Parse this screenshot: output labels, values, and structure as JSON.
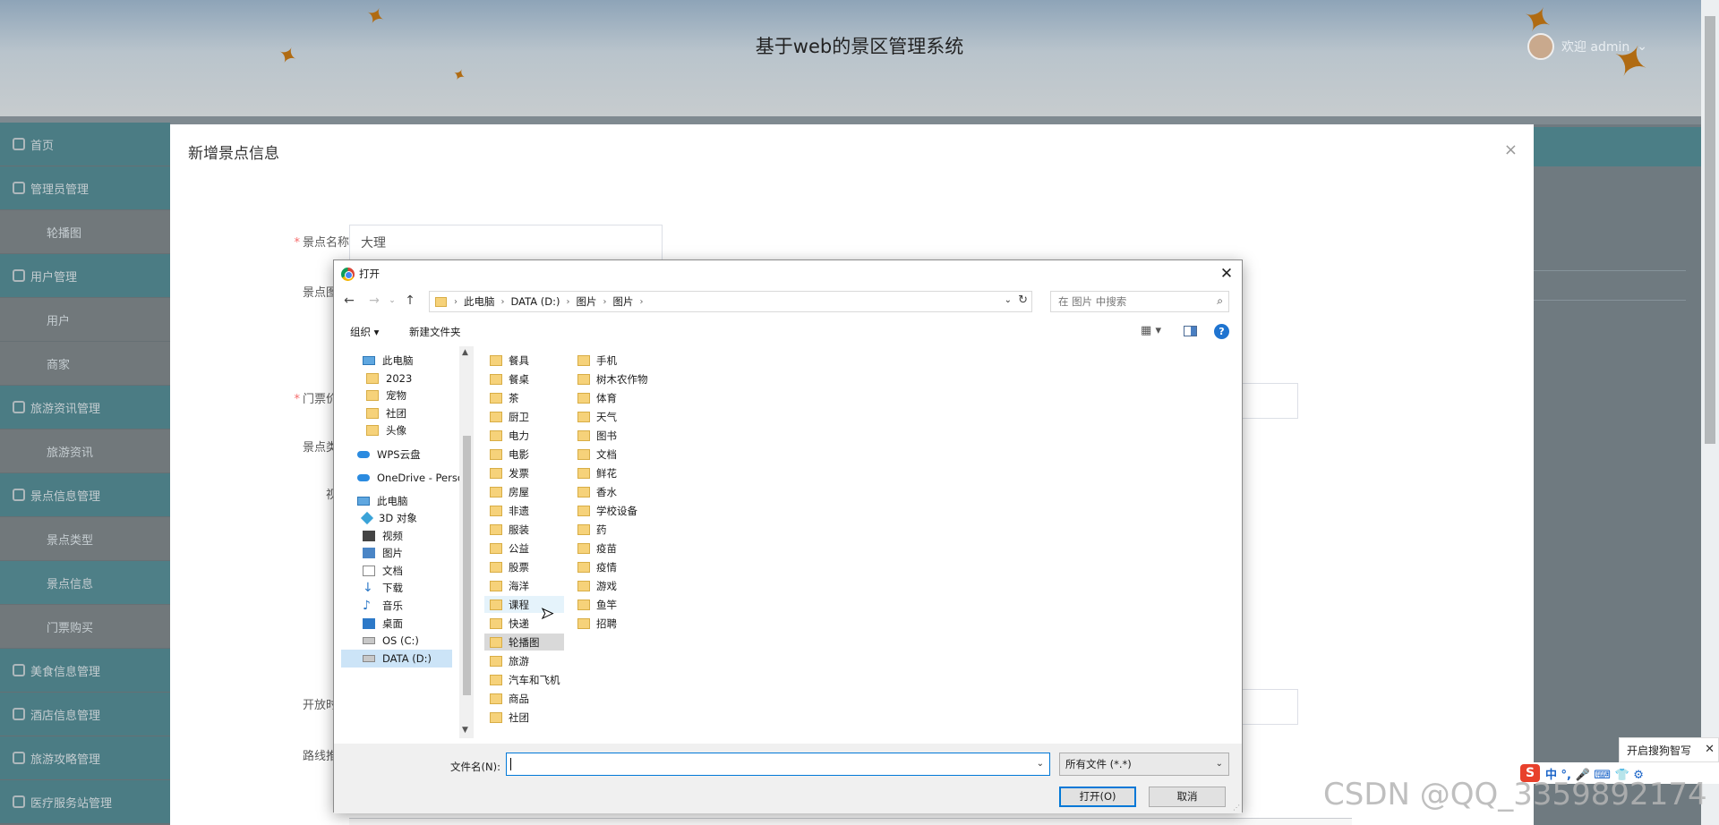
{
  "app": {
    "title": "基于web的景区管理系统",
    "welcome": "欢迎 admin"
  },
  "sidebar": {
    "items": [
      {
        "label": "首页",
        "type": "group"
      },
      {
        "label": "管理员管理",
        "type": "group"
      },
      {
        "label": "轮播图",
        "type": "sub"
      },
      {
        "label": "用户管理",
        "type": "group"
      },
      {
        "label": "用户",
        "type": "sub"
      },
      {
        "label": "商家",
        "type": "sub"
      },
      {
        "label": "旅游资讯管理",
        "type": "group"
      },
      {
        "label": "旅游资讯",
        "type": "sub"
      },
      {
        "label": "景点信息管理",
        "type": "group"
      },
      {
        "label": "景点类型",
        "type": "sub"
      },
      {
        "label": "景点信息",
        "type": "active"
      },
      {
        "label": "门票购买",
        "type": "sub"
      },
      {
        "label": "美食信息管理",
        "type": "group"
      },
      {
        "label": "酒店信息管理",
        "type": "group"
      },
      {
        "label": "旅游攻略管理",
        "type": "group"
      },
      {
        "label": "医疗服务站管理",
        "type": "group"
      }
    ]
  },
  "modal": {
    "title": "新增景点信息",
    "close_glyph": "×",
    "fields": {
      "name_label": "景点名称",
      "name_value": "大理",
      "image_label": "景点图片",
      "price_label": "门票价格",
      "type_label": "景点类型",
      "video_label": "视频",
      "open_label": "开放时间",
      "route_label": "路线推荐"
    }
  },
  "dialog": {
    "title": "打开",
    "close_glyph": "✕",
    "breadcrumb": [
      "此电脑",
      "DATA (D:)",
      "图片",
      "图片"
    ],
    "search_placeholder": "在 图片 中搜索",
    "toolbar": {
      "organize": "组织 ▾",
      "new_folder": "新建文件夹"
    },
    "nav_items": [
      {
        "label": "此电脑",
        "icon": "pc"
      },
      {
        "label": "2023",
        "icon": "folder"
      },
      {
        "label": "宠物",
        "icon": "folder"
      },
      {
        "label": "社团",
        "icon": "folder"
      },
      {
        "label": "头像",
        "icon": "folder"
      },
      {
        "label": "WPS云盘",
        "icon": "cloud"
      },
      {
        "label": "OneDrive - Perso",
        "icon": "cloud"
      },
      {
        "label": "此电脑",
        "icon": "pc"
      },
      {
        "label": "3D 对象",
        "icon": "cube"
      },
      {
        "label": "视频",
        "icon": "vid"
      },
      {
        "label": "图片",
        "icon": "pic"
      },
      {
        "label": "文档",
        "icon": "doc"
      },
      {
        "label": "下载",
        "icon": "dl"
      },
      {
        "label": "音乐",
        "icon": "music"
      },
      {
        "label": "桌面",
        "icon": "desk"
      },
      {
        "label": "OS (C:)",
        "icon": "drive"
      },
      {
        "label": "DATA (D:)",
        "icon": "drive"
      }
    ],
    "folders_col1": [
      "餐具",
      "餐桌",
      "茶",
      "厨卫",
      "电力",
      "电影",
      "发票",
      "房屋",
      "非遗",
      "服装",
      "公益",
      "股票",
      "海洋",
      "课程",
      "快递",
      "轮播图",
      "旅游",
      "汽车和飞机",
      "商品",
      "社团"
    ],
    "folders_col2": [
      "手机",
      "树木农作物",
      "体育",
      "天气",
      "图书",
      "文档",
      "鲜花",
      "香水",
      "学校设备",
      "药",
      "疫苗",
      "疫情",
      "游戏",
      "鱼竿",
      "招聘"
    ],
    "filename_label": "文件名(N):",
    "filename_value": "",
    "filetype": "所有文件 (*.*)",
    "open_button": "打开(O)",
    "cancel_button": "取消"
  },
  "overlays": {
    "sogou_tip": "开启搜狗智写",
    "ime_text": "中 °, 🎤 ⌨ 👕 ⚙",
    "watermark": "CSDN @QQ_3359892174"
  }
}
